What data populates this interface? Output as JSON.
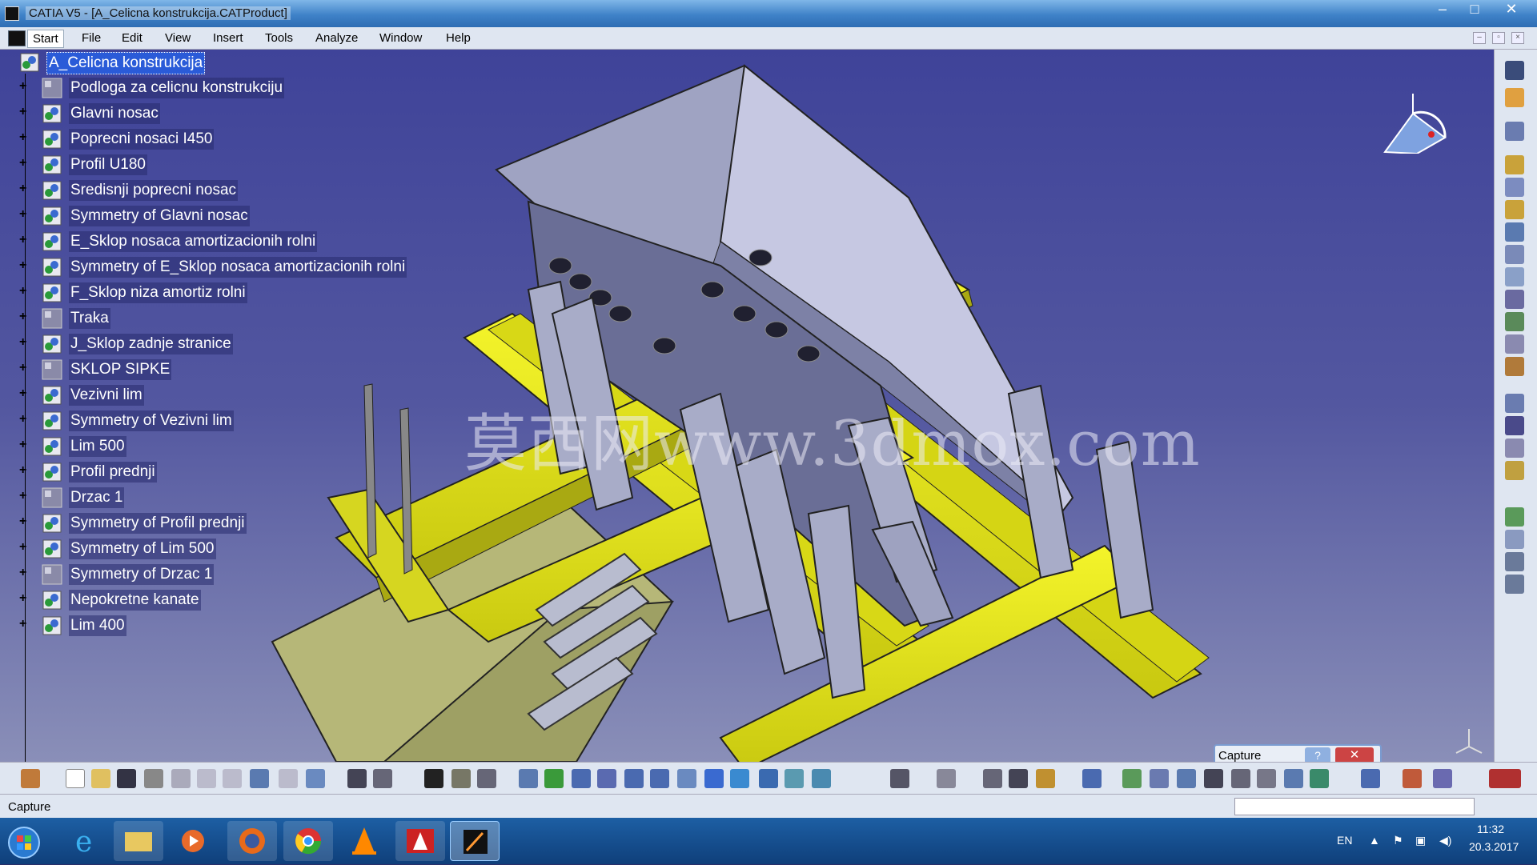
{
  "window": {
    "title": "CATIA V5 - [A_Celicna konstrukcija.CATProduct]"
  },
  "menu": {
    "items": [
      "Start",
      "File",
      "Edit",
      "View",
      "Insert",
      "Tools",
      "Analyze",
      "Window",
      "Help"
    ]
  },
  "tree": {
    "root": "A_Celicna konstrukcija",
    "items": [
      "Podloga za celicnu konstrukciju",
      "Glavni nosac",
      "Poprecni nosaci I450",
      "Profil U180",
      "Sredisnji poprecni nosac",
      "Symmetry of Glavni nosac",
      "E_Sklop nosaca amortizacionih rolni",
      "Symmetry of E_Sklop nosaca amortizacionih rolni",
      "F_Sklop niza amortiz rolni",
      "Traka",
      "J_Sklop zadnje stranice",
      "SKLOP SIPKE",
      "Vezivni lim",
      "Symmetry of Vezivni lim",
      "Lim 500",
      "Profil prednji",
      "Drzac 1",
      "Symmetry of Profil prednji",
      "Symmetry of Lim 500",
      "Symmetry of Drzac 1",
      "Nepokretne kanate",
      "Lim 400"
    ]
  },
  "watermark": "莫西网www.3dmox.com",
  "capture_dialog": {
    "title": "Capture",
    "help": "?",
    "close": "✕"
  },
  "status": {
    "text": "Capture"
  },
  "tray": {
    "lang": "EN",
    "time": "11:32",
    "date": "20.3.2017"
  },
  "colors": {
    "steel_yellow": "#e8e81c",
    "steel_grey": "#a8acc8",
    "background_top": "#3f4399",
    "selection": "#2a5bd8"
  }
}
